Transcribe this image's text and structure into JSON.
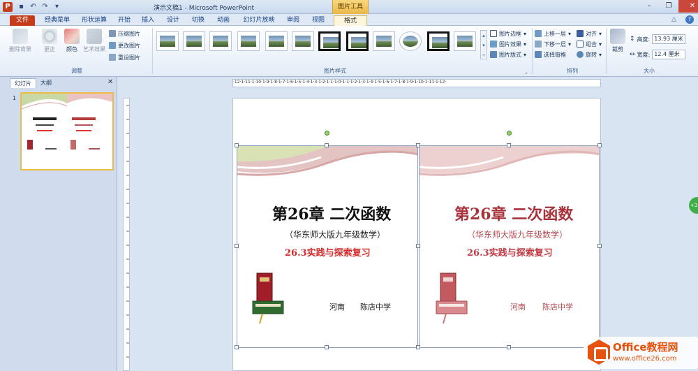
{
  "window": {
    "title": "演示文稿1 - Microsoft PowerPoint",
    "contextual_tab_group": "图片工具",
    "app_icon": "P"
  },
  "tabs": [
    {
      "label": "文件"
    },
    {
      "label": "经典菜单"
    },
    {
      "label": "形状运算"
    },
    {
      "label": "开始"
    },
    {
      "label": "插入"
    },
    {
      "label": "设计"
    },
    {
      "label": "切换"
    },
    {
      "label": "动画"
    },
    {
      "label": "幻灯片放映"
    },
    {
      "label": "审阅"
    },
    {
      "label": "视图"
    },
    {
      "label": "格式"
    }
  ],
  "ribbon": {
    "adjust": {
      "remove_bg": "删除背景",
      "corrections": "更正",
      "color": "颜色",
      "artistic": "艺术效果",
      "compress": "压缩图片",
      "change": "更改图片",
      "reset": "重设图片",
      "label": "调整"
    },
    "styles": {
      "label": "图片样式",
      "border": "图片边框",
      "effects": "图片效果",
      "layout": "图片版式"
    },
    "arrange": {
      "label": "排列",
      "bring_forward": "上移一层",
      "send_backward": "下移一层",
      "selection_pane": "选择窗格",
      "align": "对齐",
      "group": "组合",
      "rotate": "旋转"
    },
    "size": {
      "label": "大小",
      "crop": "裁剪",
      "height_label": "高度:",
      "height_value": "13.93 厘米",
      "width_label": "宽度:",
      "width_value": "12.4 厘米"
    }
  },
  "left_pane": {
    "tab_slides": "幻灯片",
    "tab_outline": "大纲",
    "slide_number": "1"
  },
  "ruler": {
    "h_ticks": "·12·1·11·1·10·1·9·1·8·1·7·1·6·1·5·1·4·1·3·1·2·1·1·1·0·1·1·1·2·1·3·1·4·1·5·1·6·1·7·1·8·1·9·1·10·1·11·1·12·"
  },
  "slide": {
    "left": {
      "title": "第26章 二次函数",
      "subtitle": "（华东师大版九年级数学）",
      "section": "26.3实践与探索复习",
      "place": "河南",
      "school": "陈店中学"
    },
    "right": {
      "title": "第26章 二次函数",
      "subtitle": "（华东师大版九年级数学）",
      "section": "26.3实践与探索复习",
      "place": "河南",
      "school": "陈店中学"
    }
  },
  "watermark": {
    "brand": "Office教程网",
    "url": "www.office26.com"
  },
  "badge": "+3"
}
